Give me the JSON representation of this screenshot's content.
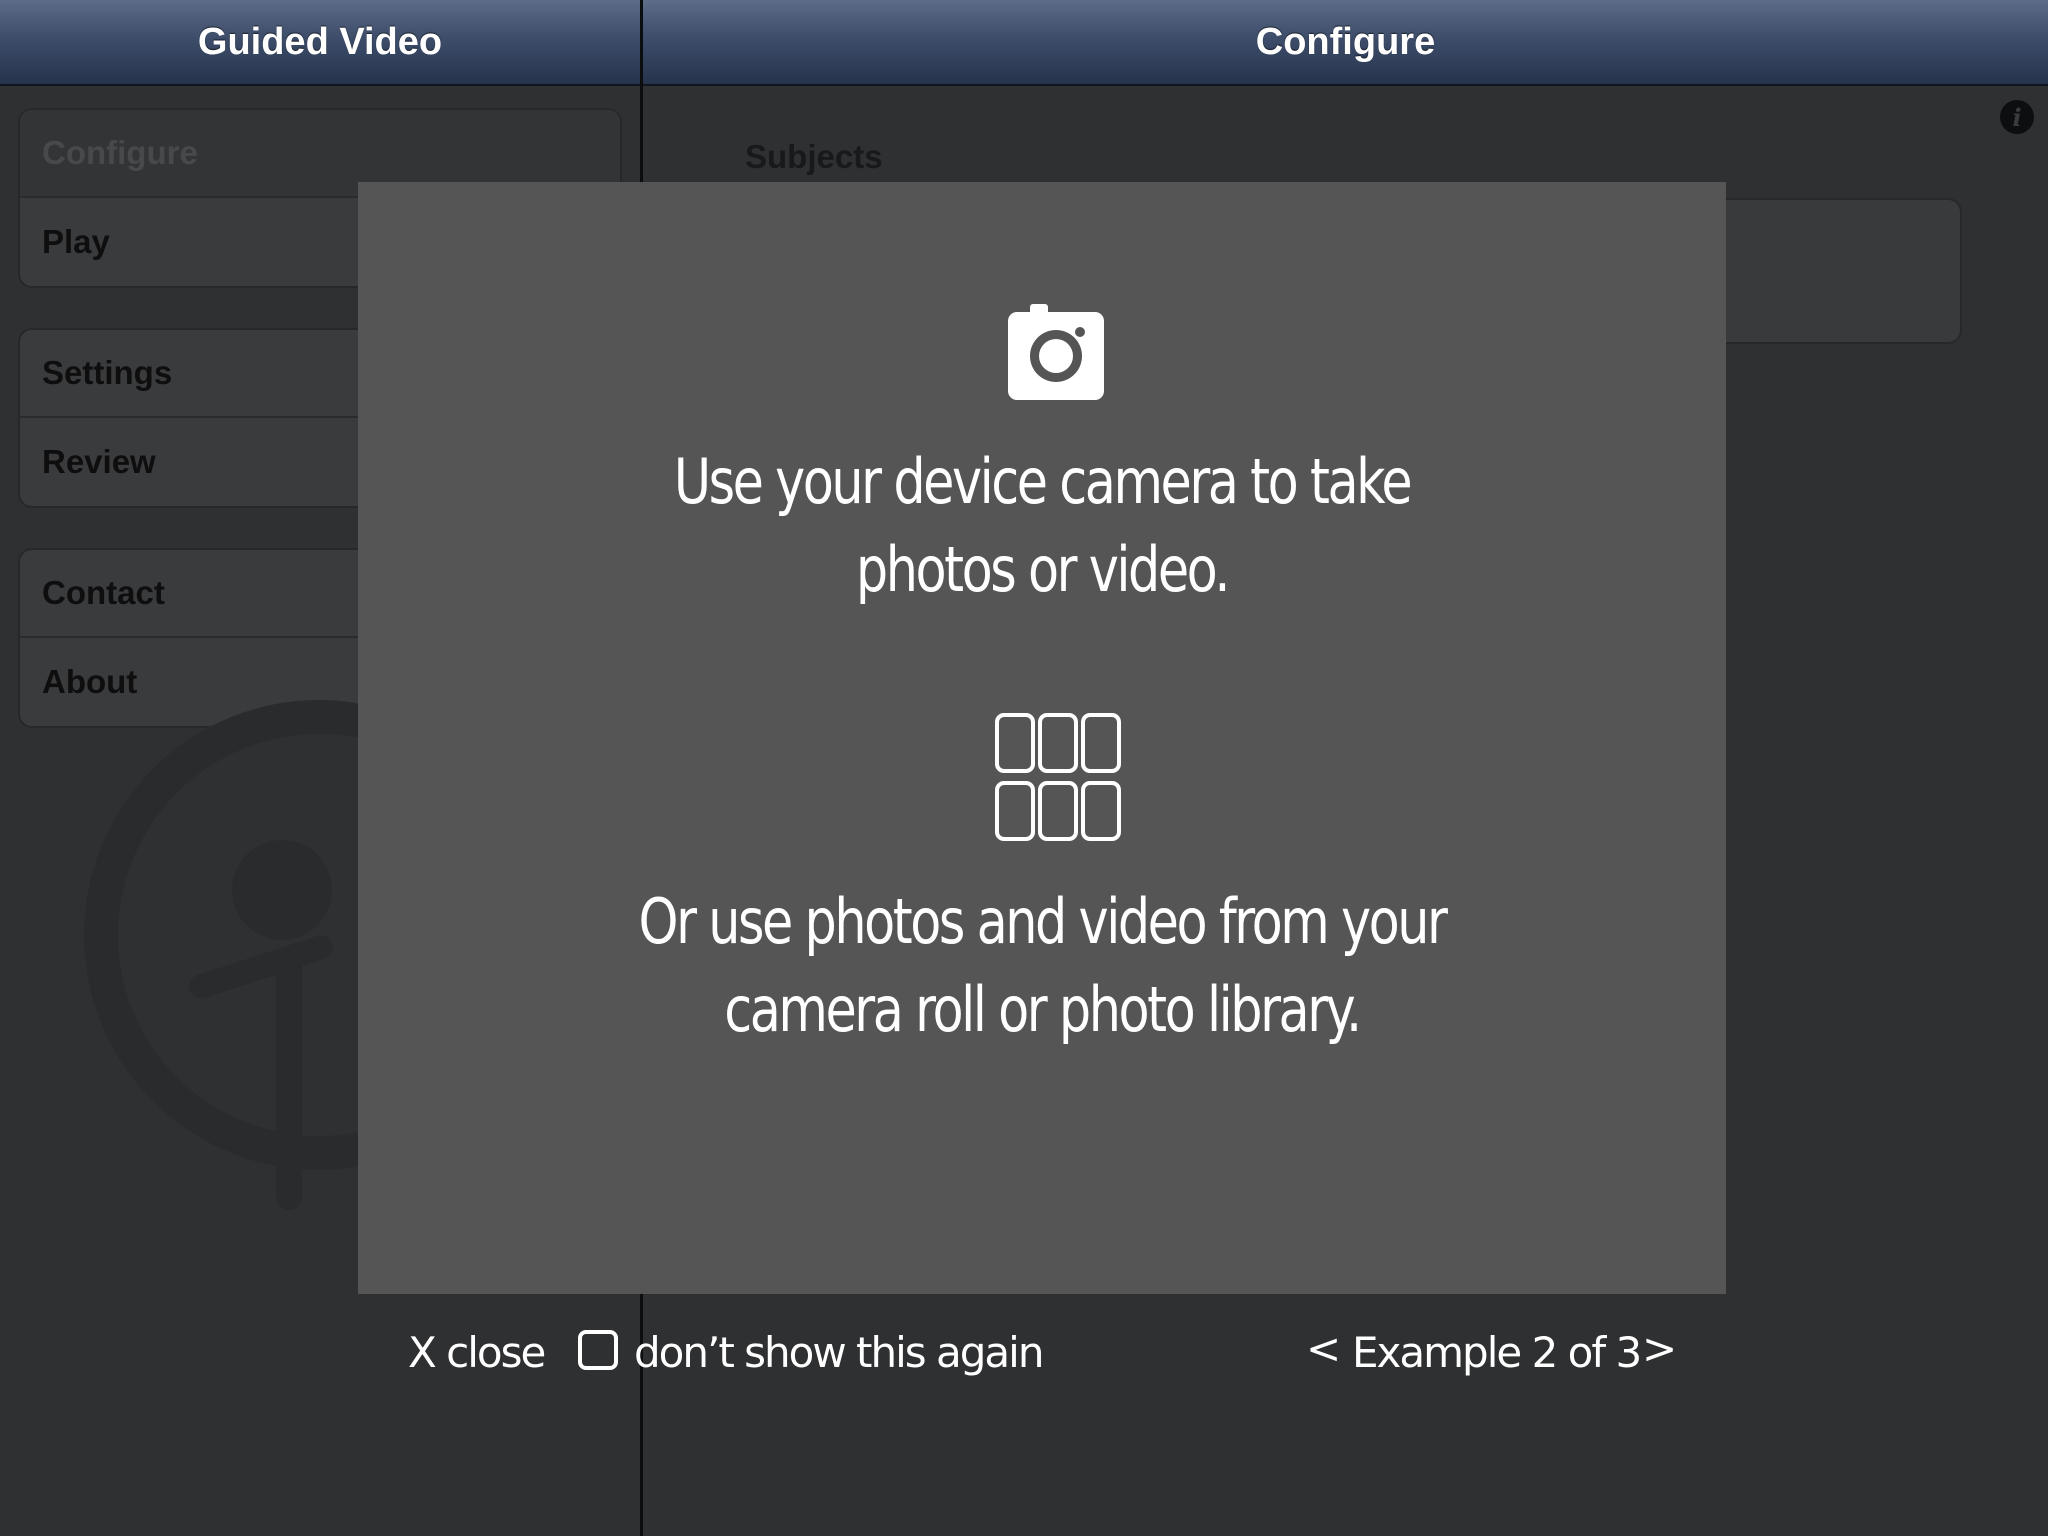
{
  "nav": {
    "left_title": "Guided Video",
    "right_title": "Configure"
  },
  "sidebar": {
    "groups": [
      {
        "items": [
          {
            "label": "Configure",
            "selected": true
          },
          {
            "label": "Play"
          }
        ]
      },
      {
        "items": [
          {
            "label": "Settings"
          },
          {
            "label": "Review"
          }
        ]
      },
      {
        "items": [
          {
            "label": "Contact"
          },
          {
            "label": "About"
          }
        ]
      }
    ]
  },
  "detail": {
    "section_label": "Subjects",
    "info_icon": "info-icon"
  },
  "modal": {
    "camera_icon": "camera-icon",
    "message_1_line_1": "Use your device camera to take",
    "message_1_line_2": "photos or video.",
    "grid_icon": "photo-grid-icon",
    "message_2_line_1": "Or use photos and video from your",
    "message_2_line_2": "camera roll or photo library."
  },
  "controls": {
    "close_label": "X close",
    "dont_show_label": "don’t show this again",
    "dont_show_checked": false,
    "prev_label": "<",
    "page_label": "Example 2 of 3",
    "next_label": ">"
  }
}
